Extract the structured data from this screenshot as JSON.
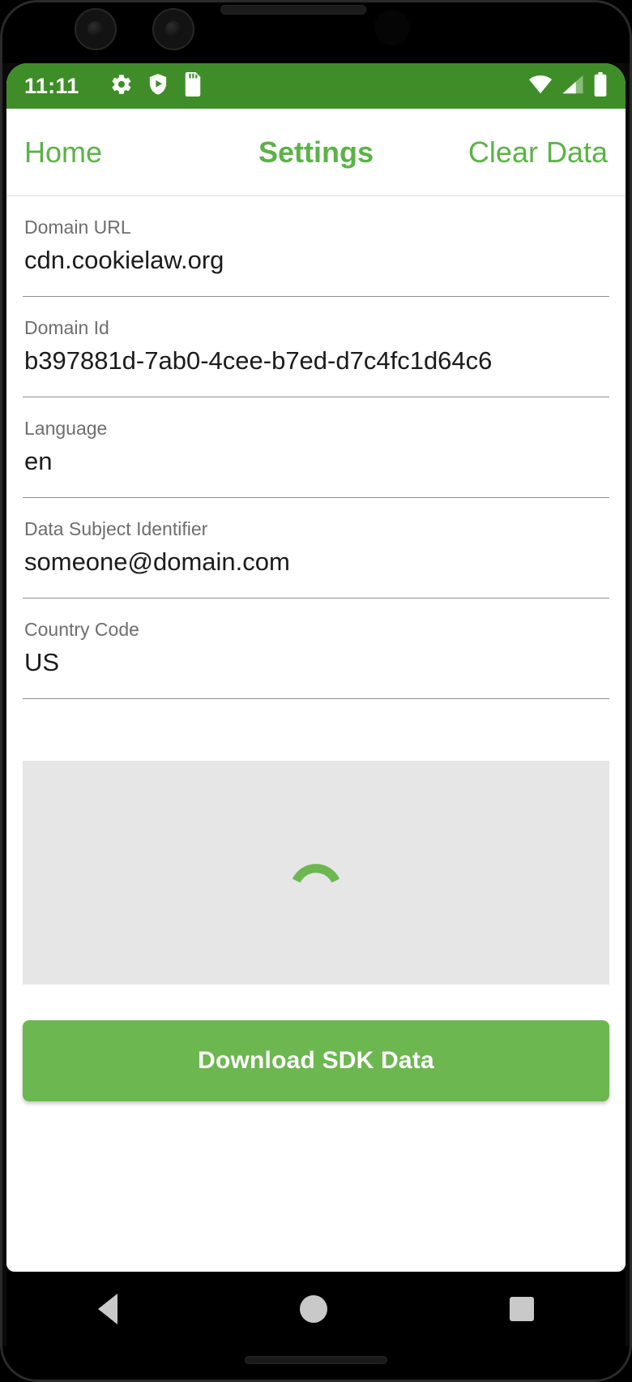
{
  "status_bar": {
    "time": "11:11",
    "left_icons": [
      "gear-icon",
      "shield-play-icon",
      "sd-card-icon"
    ],
    "right_icons": [
      "wifi-icon",
      "cellular-signal-icon",
      "battery-icon"
    ],
    "background_color": "#3f8d28"
  },
  "app_bar": {
    "back_label": "Home",
    "title": "Settings",
    "action_label": "Clear Data",
    "accent_color": "#5cb248"
  },
  "settings_form": {
    "fields": [
      {
        "label": "Domain URL",
        "value": "cdn.cookielaw.org"
      },
      {
        "label": "Domain Id",
        "value": "b397881d-7ab0-4cee-b7ed-d7c4fc1d64c6"
      },
      {
        "label": "Language",
        "value": "en"
      },
      {
        "label": "Data Subject Identifier",
        "value": "someone@domain.com"
      },
      {
        "label": "Country Code",
        "value": "US"
      }
    ]
  },
  "loading_panel": {
    "spinner_icon": "loading-arc-icon",
    "spinner_color": "#6cb74f",
    "panel_color": "#e6e6e6"
  },
  "download_button": {
    "label": "Download SDK Data",
    "background_color": "#6cb74f",
    "text_color": "#ffffff"
  },
  "system_nav": {
    "back_icon": "triangle-back-icon",
    "home_icon": "circle-home-icon",
    "recents_icon": "square-recents-icon"
  }
}
